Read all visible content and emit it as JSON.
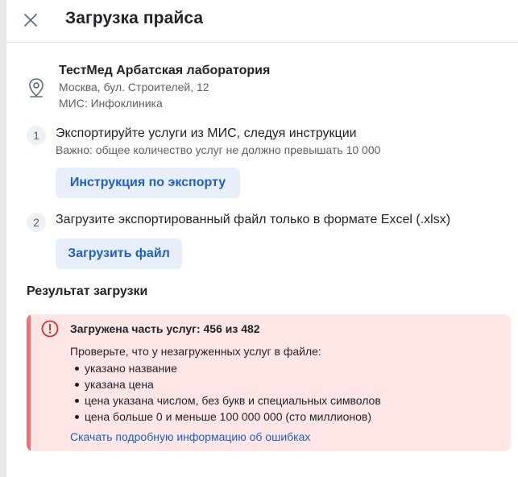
{
  "header": {
    "title": "Загрузка прайса",
    "close_icon": "close-icon"
  },
  "clinic": {
    "icon": "location-pin-icon",
    "name": "ТестМед Арбатская лаборатория",
    "address": "Москва, бул. Строителей, 12",
    "mis": "МИС: Инфоклиника"
  },
  "steps": [
    {
      "number": "1",
      "title": "Экспортируйте услуги из МИС, следуя инструкции",
      "note": "Важно: общее количество услуг не должно превышать 10 000",
      "button_label": "Инструкция по экспорту"
    },
    {
      "number": "2",
      "title": "Загрузите экспортированный файл только в формате Excel (.xlsx)",
      "button_label": "Загрузить файл"
    }
  ],
  "result": {
    "heading": "Результат загрузки",
    "status_icon": "error-icon",
    "title": "Загружена часть услуг: 456 из 482",
    "uploaded": 456,
    "total": 482,
    "intro": "Проверьте, что у незагруженных услуг в файле:",
    "checks": [
      "указано название",
      "указана цена",
      "цена указана числом, без букв и специальных символов",
      "цена больше 0 и меньше 100 000 000 (сто миллионов)"
    ],
    "link_label": "Скачать подробную информацию об ошибках"
  },
  "colors": {
    "accent": "#1e5fcf",
    "button_bg": "#e9effa",
    "error_bg": "#fde6e5",
    "error_accent": "#f0706f",
    "error_icon": "#d63031"
  }
}
